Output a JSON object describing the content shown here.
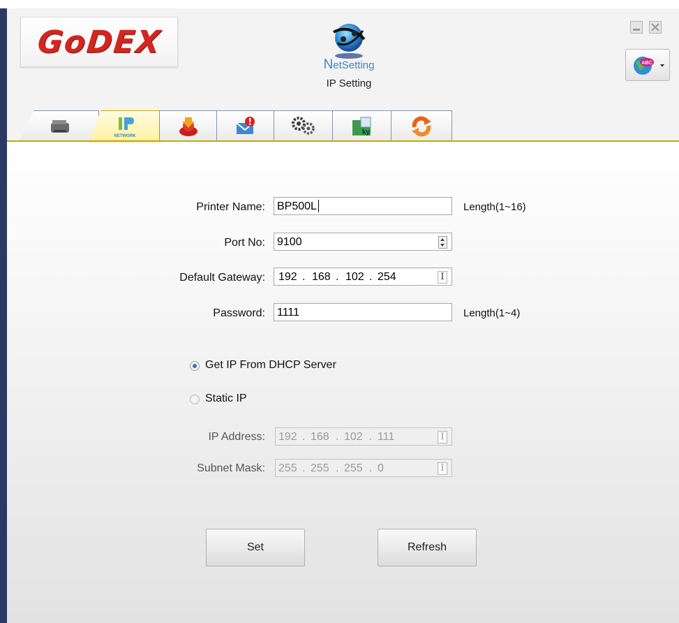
{
  "app": {
    "logo_text": "GoDEX",
    "name_first": "N",
    "name_rest": "etSetting",
    "page_title": "IP Setting"
  },
  "tabs": [
    {
      "icon": "printer-icon",
      "label": "",
      "active": false
    },
    {
      "icon": "ip-network-icon",
      "label": "NETWORK",
      "active": true
    },
    {
      "icon": "download-icon",
      "label": "",
      "active": false
    },
    {
      "icon": "mail-alert-icon",
      "label": "",
      "active": false
    },
    {
      "icon": "gears-icon",
      "label": "",
      "active": false
    },
    {
      "icon": "keyboard-icon",
      "label": "",
      "active": false
    },
    {
      "icon": "refresh-arrows-icon",
      "label": "",
      "active": false
    }
  ],
  "form": {
    "printer_name_label": "Printer Name:",
    "printer_name_value": "BP500L",
    "printer_name_hint": "Length(1~16)",
    "port_label": "Port No:",
    "port_value": "9100",
    "gateway_label": "Default Gateway:",
    "gateway": [
      "192",
      "168",
      "102",
      "254"
    ],
    "password_label": "Password:",
    "password_value": "1111",
    "password_hint": "Length(1~4)",
    "dhcp_label": "Get IP From DHCP Server",
    "static_label": "Static IP",
    "selected_mode": "dhcp",
    "ip_label": "IP Address:",
    "ip": [
      "192",
      "168",
      "102",
      "111"
    ],
    "subnet_label": "Subnet Mask:",
    "subnet": [
      "255",
      "255",
      "255",
      "0"
    ],
    "ip_separator": "."
  },
  "buttons": {
    "set_label": "Set",
    "refresh_label": "Refresh"
  },
  "colors": {
    "logo_red": "#d2261f",
    "accent_blue": "#3a86c8",
    "active_tab": "#fff1a0",
    "left_bar": "#2b3a63"
  }
}
